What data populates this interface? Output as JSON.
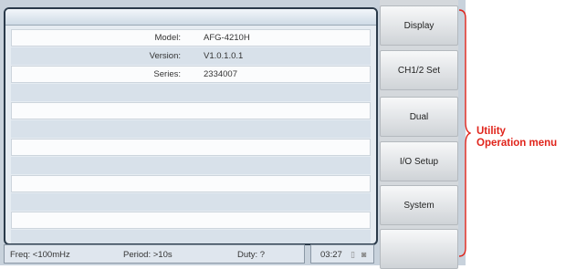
{
  "system_info": {
    "rows": [
      {
        "label": "Model:",
        "value": "AFG-4210H"
      },
      {
        "label": "Version:",
        "value": "V1.0.1.0.1"
      },
      {
        "label": "Series:",
        "value": "2334007"
      }
    ]
  },
  "status_bar": {
    "freq": "Freq: <100mHz",
    "period": "Period: >10s",
    "duty": "Duty: ?",
    "time": "03:27"
  },
  "softkeys": [
    "Display",
    "CH1/2 Set",
    "Dual",
    "I/O Setup",
    "System",
    ""
  ],
  "annotation": {
    "line1": "Utility",
    "line2": "Operation menu",
    "color": "#e0241b"
  },
  "icons": {
    "usb": "usb-icon",
    "lock": "lock-icon"
  }
}
